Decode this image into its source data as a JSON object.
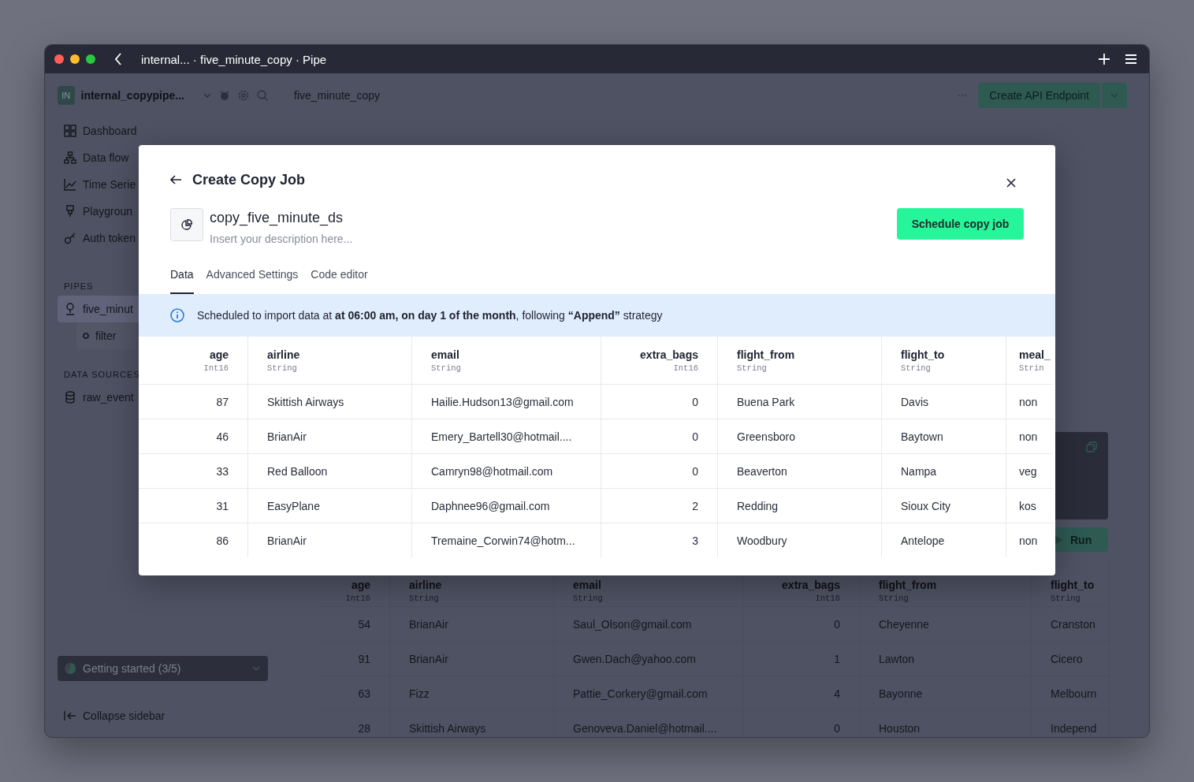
{
  "window": {
    "title": "internal... · five_minute_copy · Pipe"
  },
  "sidebar": {
    "workspace": {
      "initials": "IN",
      "name": "internal_copypipe..."
    },
    "nav": [
      {
        "label": "Dashboard",
        "kind": "dashboard"
      },
      {
        "label": "Data flow",
        "kind": "dataflow"
      },
      {
        "label": "Time Serie",
        "kind": "timeseries"
      },
      {
        "label": "Playgroun",
        "kind": "playground"
      },
      {
        "label": "Auth token",
        "kind": "token"
      }
    ],
    "sections": [
      {
        "title": "PIPES",
        "items": [
          {
            "label": "five_minut",
            "kind": "pipe",
            "selected": true,
            "children": [
              {
                "label": "filter"
              }
            ]
          }
        ]
      },
      {
        "title": "DATA SOURCES",
        "items": [
          {
            "label": "raw_event",
            "kind": "datasource",
            "selected": false
          }
        ]
      }
    ],
    "getting_started": "Getting started (3/5)",
    "collapse": "Collapse sidebar"
  },
  "header": {
    "breadcrumb": "five_minute_copy",
    "primary_button": "Create API Endpoint"
  },
  "run_button": "Run",
  "background_table": {
    "columns": [
      {
        "name": "age",
        "type": "Int16",
        "kind": "number"
      },
      {
        "name": "airline",
        "type": "String",
        "kind": "text"
      },
      {
        "name": "email",
        "type": "String",
        "kind": "text"
      },
      {
        "name": "extra_bags",
        "type": "Int16",
        "kind": "number"
      },
      {
        "name": "flight_from",
        "type": "String",
        "kind": "text"
      },
      {
        "name": "flight_to",
        "type": "String",
        "kind": "text"
      }
    ],
    "rows": [
      [
        "54",
        "BrianAir",
        "Saul_Olson@gmail.com",
        "0",
        "Cheyenne",
        "Cranston"
      ],
      [
        "91",
        "BrianAir",
        "Gwen.Dach@yahoo.com",
        "1",
        "Lawton",
        "Cicero"
      ],
      [
        "63",
        "Fizz",
        "Pattie_Corkery@gmail.com",
        "4",
        "Bayonne",
        "Melbourn"
      ],
      [
        "28",
        "Skittish Airways",
        "Genoveva.Daniel@hotmail....",
        "0",
        "Houston",
        "Independ"
      ]
    ]
  },
  "modal": {
    "title": "Create Copy Job",
    "name": "copy_five_minute_ds",
    "description": {
      "placeholder": "Insert your description here..."
    },
    "primary_button": "Schedule copy job",
    "tabs": [
      {
        "label": "Data",
        "selected": true
      },
      {
        "label": "Advanced Settings",
        "selected": false
      },
      {
        "label": "Code editor",
        "selected": false
      }
    ],
    "notice": "Scheduled to import data at **at 06:00 am, on day 1 of the month**, following **“Append”** strategy",
    "table": {
      "columns": [
        {
          "name": "age",
          "type": "Int16",
          "kind": "number"
        },
        {
          "name": "airline",
          "type": "String",
          "kind": "text"
        },
        {
          "name": "email",
          "type": "String",
          "kind": "text"
        },
        {
          "name": "extra_bags",
          "type": "Int16",
          "kind": "number"
        },
        {
          "name": "flight_from",
          "type": "String",
          "kind": "text"
        },
        {
          "name": "flight_to",
          "type": "String",
          "kind": "text"
        },
        {
          "name": "meal_",
          "type": "Strin",
          "kind": "text"
        }
      ],
      "rows": [
        [
          "87",
          "Skittish Airways",
          "Hailie.Hudson13@gmail.com",
          "0",
          "Buena Park",
          "Davis",
          "non"
        ],
        [
          "46",
          "BrianAir",
          "Emery_Bartell30@hotmail....",
          "0",
          "Greensboro",
          "Baytown",
          "non"
        ],
        [
          "33",
          "Red Balloon",
          "Camryn98@hotmail.com",
          "0",
          "Beaverton",
          "Nampa",
          "veg"
        ],
        [
          "31",
          "EasyPlane",
          "Daphnee96@gmail.com",
          "2",
          "Redding",
          "Sioux City",
          "kos"
        ],
        [
          "86",
          "BrianAir",
          "Tremaine_Corwin74@hotm...",
          "3",
          "Woodbury",
          "Antelope",
          "non"
        ]
      ]
    }
  }
}
